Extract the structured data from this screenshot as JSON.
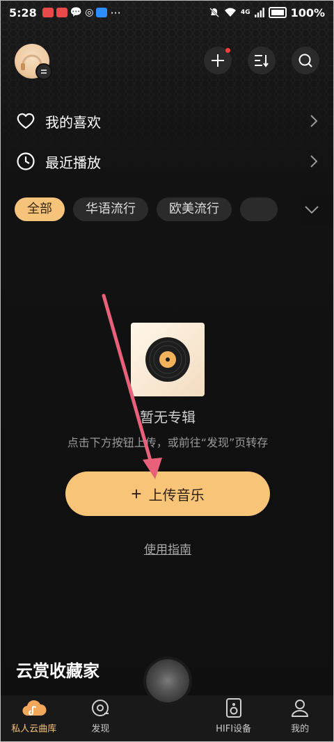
{
  "status_bar": {
    "time": "5:28",
    "battery": "100%",
    "network": "4G"
  },
  "header": {
    "add_label": "+",
    "sort_label": "sort",
    "search_label": "search"
  },
  "rows": [
    {
      "label": "我的喜欢",
      "icon": "heart-icon"
    },
    {
      "label": "最近播放",
      "icon": "clock-icon"
    }
  ],
  "chips": [
    "全部",
    "华语流行",
    "欧美流行"
  ],
  "empty": {
    "title": "暂无专辑",
    "subtitle": "点击下方按钮上传，或前往“发现”页转存",
    "upload_label": "上传音乐",
    "guide_label": "使用指南"
  },
  "section_title": "云赏收藏家",
  "tabs": [
    {
      "label": "私人云曲库",
      "icon": "cloud-library-icon",
      "active": true
    },
    {
      "label": "发现",
      "icon": "discover-icon",
      "active": false
    },
    {
      "label": "",
      "icon": "disc-icon",
      "active": false
    },
    {
      "label": "HIFI设备",
      "icon": "speaker-icon",
      "active": false
    },
    {
      "label": "我的",
      "icon": "profile-icon",
      "active": false
    }
  ],
  "colors": {
    "accent": "#f7c478",
    "background": "#101010",
    "chip": "#2b2b2b",
    "annotation_arrow": "#e8607a"
  }
}
